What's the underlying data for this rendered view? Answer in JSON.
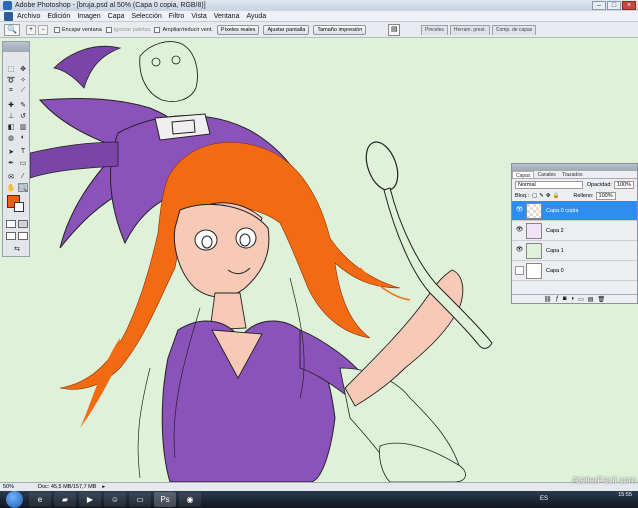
{
  "window": {
    "title": "Adobe Photoshop - [bruja.psd al 50% (Capa 0 copia, RGB/8)]"
  },
  "menu": [
    "Archivo",
    "Edición",
    "Imagen",
    "Capa",
    "Selección",
    "Filtro",
    "Vista",
    "Ventana",
    "Ayuda"
  ],
  "options": {
    "encajar": "Encajar ventana",
    "ignorar": "Ignorar paletas",
    "ampliar": "Ampliar/reducir vent.",
    "pixeles": "Píxeles reales",
    "ajustar": "Ajustar pantalla",
    "tamano": "Tamaño impresión"
  },
  "panel_well": [
    "Pinceles",
    "Herram. prest.",
    "Comp. de capas"
  ],
  "layers_panel": {
    "tabs": [
      "Capas",
      "Canales",
      "Trazados"
    ],
    "blend_mode": "Normal",
    "opacity_label": "Opacidad:",
    "opacity": "100%",
    "lock_label": "Bloq.:",
    "fill_label": "Relleno:",
    "fill": "100%",
    "layers": [
      {
        "name": "Capa 0 copia",
        "visible": true,
        "active": true
      },
      {
        "name": "Capa 2",
        "visible": true,
        "active": false
      },
      {
        "name": "Capa 1",
        "visible": true,
        "active": false
      },
      {
        "name": "Capa 0",
        "visible": false,
        "active": false
      }
    ]
  },
  "status": {
    "zoom": "50%",
    "doc": "Doc: 45,5 MB/157,7 MB"
  },
  "taskbar": {
    "lang": "ES",
    "time": "15:55"
  },
  "watermark": "AtelierFacil.com",
  "colors": {
    "foreground": "#ee5f16",
    "background": "#ffffff",
    "canvas": "#dff2d9",
    "hat": "#8b52ba",
    "hair": "#f26a12",
    "skin": "#f6cab6",
    "layer_selected": "#2f8df0"
  },
  "icons": {
    "zoom_tool": "magnifier-icon",
    "eye": "eye-icon",
    "start": "windows-start-icon"
  }
}
